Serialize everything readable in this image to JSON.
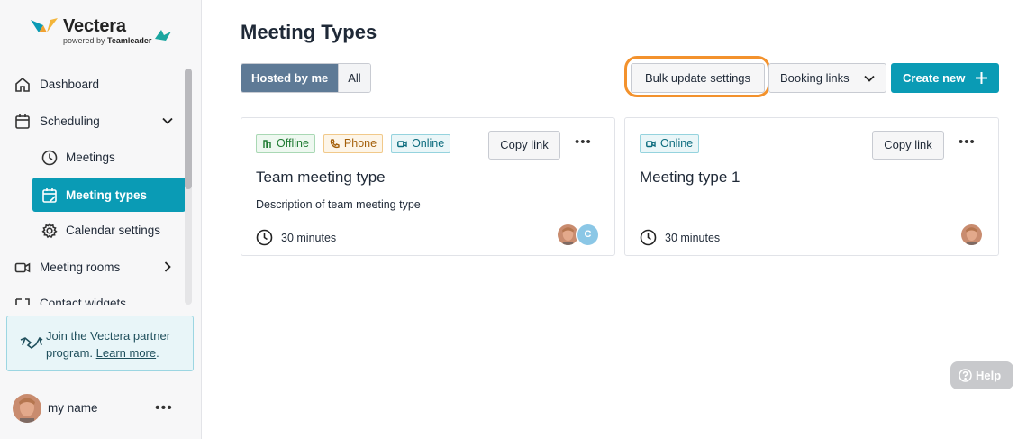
{
  "brand": {
    "name": "Vectera",
    "powered_prefix": "powered by",
    "powered_brand": "Teamleader"
  },
  "sidebar": {
    "items": [
      {
        "label": "Dashboard",
        "icon": "home-icon"
      },
      {
        "label": "Scheduling",
        "icon": "calendar-icon",
        "expanded": true
      },
      {
        "label": "Meetings",
        "icon": "clock-icon"
      },
      {
        "label": "Meeting types",
        "icon": "calendar-edit-icon",
        "active": true
      },
      {
        "label": "Calendar settings",
        "icon": "gear-icon"
      },
      {
        "label": "Meeting rooms",
        "icon": "video-icon"
      },
      {
        "label": "Contact widgets",
        "icon": "widget-icon"
      }
    ],
    "partner": {
      "text": "Join the Vectera partner program.",
      "text_prefix": "Join the Vectera partner program. ",
      "link": "Learn more",
      "suffix": "."
    },
    "profile": {
      "name": "my name",
      "more": "•••"
    }
  },
  "main": {
    "title": "Meeting Types",
    "filters": {
      "hosted": "Hosted by me",
      "all": "All",
      "selected": "Hosted by me"
    },
    "actions": {
      "bulk": "Bulk update settings",
      "booking": "Booking links",
      "create": "Create new"
    },
    "cards": [
      {
        "tags": [
          "Offline",
          "Phone",
          "Online"
        ],
        "copy": "Copy link",
        "more": "•••",
        "title": "Team meeting type",
        "description": "Description of team meeting type",
        "duration": "30 minutes",
        "avatars": [
          "photo",
          "C"
        ]
      },
      {
        "tags": [
          "Online"
        ],
        "copy": "Copy link",
        "more": "•••",
        "title": "Meeting type 1",
        "description": "",
        "duration": "30 minutes",
        "avatars": [
          "photo"
        ]
      }
    ],
    "help": "Help"
  },
  "colors": {
    "accent": "#0a9bb5",
    "segment_active": "#5e7a96",
    "highlight": "#f3922d"
  }
}
